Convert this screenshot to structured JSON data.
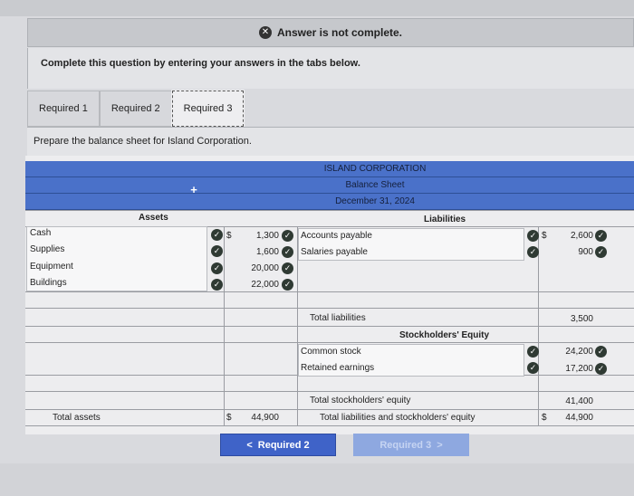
{
  "banner": {
    "status": "Answer is not complete."
  },
  "instruction": "Complete this question by entering your answers in the tabs below.",
  "tabs": [
    "Required 1",
    "Required 2",
    "Required 3"
  ],
  "prompt": "Prepare the balance sheet for Island Corporation.",
  "sheet": {
    "company": "ISLAND CORPORATION",
    "statement": "Balance Sheet",
    "date": "December 31, 2024",
    "assets_header": "Assets",
    "liabilities_header": "Liabilities",
    "equity_header": "Stockholders' Equity",
    "assets": [
      {
        "label": "Cash",
        "currency": "$",
        "value": "1,300"
      },
      {
        "label": "Supplies",
        "currency": "",
        "value": "1,600"
      },
      {
        "label": "Equipment",
        "currency": "",
        "value": "20,000"
      },
      {
        "label": "Buildings",
        "currency": "",
        "value": "22,000"
      }
    ],
    "liabilities": [
      {
        "label": "Accounts payable",
        "currency": "$",
        "value": "2,600"
      },
      {
        "label": "Salaries payable",
        "currency": "",
        "value": "900"
      }
    ],
    "total_liabilities_label": "Total liabilities",
    "total_liabilities_value": "3,500",
    "equity": [
      {
        "label": "Common stock",
        "value": "24,200"
      },
      {
        "label": "Retained earnings",
        "value": "17,200"
      }
    ],
    "total_equity_label": "Total stockholders' equity",
    "total_equity_value": "41,400",
    "total_assets_label": "Total assets",
    "total_assets_currency": "$",
    "total_assets_value": "44,900",
    "total_le_label": "Total liabilities and stockholders' equity",
    "total_le_currency": "$",
    "total_le_value": "44,900"
  },
  "nav": {
    "prev_label": "Required 2",
    "next_label": "Required 3",
    "prev_arrow": "<",
    "next_arrow": ">"
  },
  "icons": {
    "check": "✓",
    "close": "✕",
    "plus": "+"
  }
}
